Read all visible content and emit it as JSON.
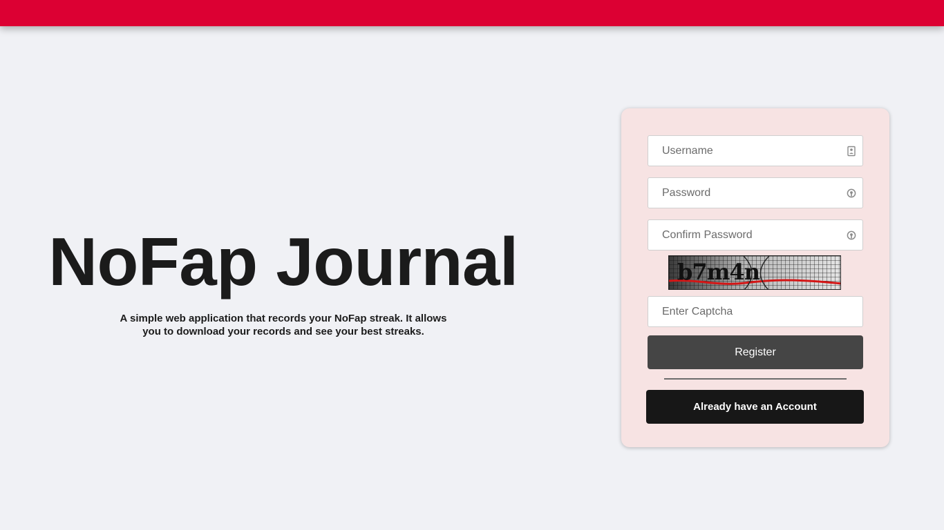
{
  "hero": {
    "title": "NoFap Journal",
    "description": "A simple web application that records your NoFap streak. It allows you to download your records and see your best streaks."
  },
  "form": {
    "username": {
      "placeholder": "Username",
      "value": "",
      "icon": "user-card-icon"
    },
    "password": {
      "placeholder": "Password",
      "value": "",
      "icon": "key-lock-icon"
    },
    "confirm_password": {
      "placeholder": "Confirm Password",
      "value": "",
      "icon": "key-lock-icon"
    },
    "captcha_image_text": "b7m4n",
    "captcha_input": {
      "placeholder": "Enter Captcha",
      "value": ""
    },
    "register_label": "Register",
    "account_label": "Already have an Account"
  },
  "colors": {
    "topbar": "#dc0033",
    "page_background": "#f0f1f5",
    "card_background": "#f7e3e3",
    "register_button": "#454545",
    "account_button": "#171717"
  }
}
